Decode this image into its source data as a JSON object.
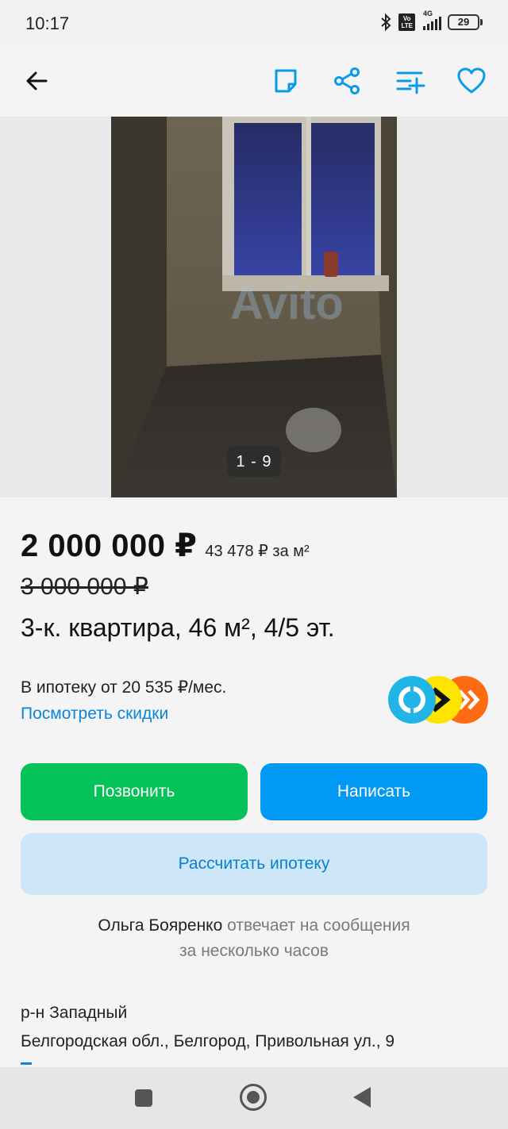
{
  "status_bar": {
    "time": "10:17",
    "network": "4G",
    "volte": "Vo LTE",
    "battery": "29"
  },
  "app_bar": {
    "icons": [
      "back-arrow-icon",
      "note-icon",
      "share-icon",
      "compare-icon",
      "heart-icon"
    ]
  },
  "gallery": {
    "counter": "1 - 9",
    "watermark": "Avito"
  },
  "listing": {
    "price": "2 000 000 ₽",
    "price_per_m2": "43 478 ₽ за м²",
    "old_price": "3 000 000 ₽",
    "title": "3-к. квартира, 46 м², 4/5 эт."
  },
  "mortgage": {
    "text": "В ипотеку от 20 535 ₽/мес.",
    "link": "Посмотреть скидки"
  },
  "actions": {
    "call": "Позвонить",
    "write": "Написать",
    "calc": "Рассчитать ипотеку"
  },
  "seller": {
    "name": "Ольга Бояренко",
    "response_a": "отвечает на сообщения",
    "response_b": "за несколько часов"
  },
  "address": {
    "district": "р-н Западный",
    "full": "Белгородская обл., Белгород, Привольная ул., 9"
  },
  "colors": {
    "call": "#04c257",
    "write": "#0299f5",
    "calc_bg": "#cde7f8",
    "link": "#0a86d8",
    "accent": "#0a9ae8"
  }
}
